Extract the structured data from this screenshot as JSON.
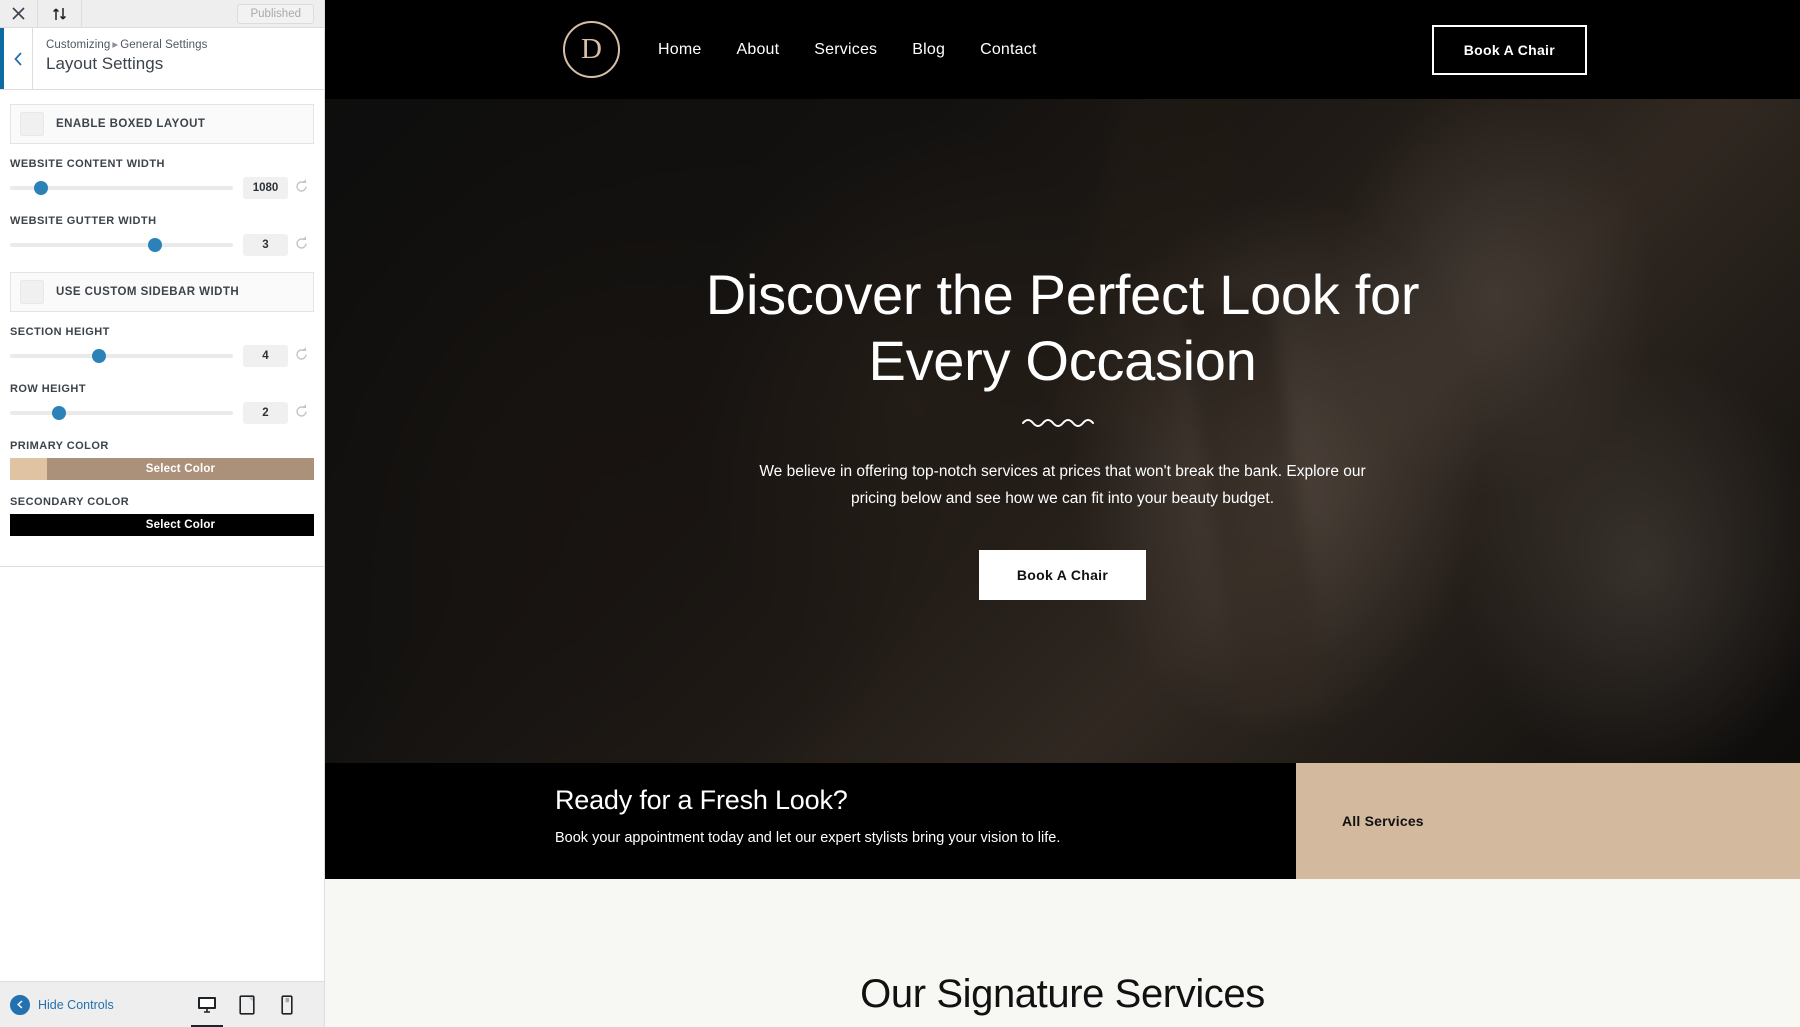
{
  "customizer": {
    "topbar": {
      "close_icon": "close-icon",
      "collapse_icon": "sort-arrows-icon",
      "published_label": "Published"
    },
    "header": {
      "back_icon": "chevron-left-icon",
      "breadcrumb_root": "Customizing",
      "breadcrumb_sep": "▸",
      "breadcrumb_section": "General Settings",
      "panel_title": "Layout Settings"
    },
    "controls": {
      "enable_boxed_layout": "ENABLE BOXED LAYOUT",
      "use_custom_sidebar_width": "USE CUSTOM SIDEBAR WIDTH",
      "sliders": [
        {
          "label": "WEBSITE CONTENT WIDTH",
          "value": "1080",
          "percent": 14,
          "reset_icon": "reset-icon"
        },
        {
          "label": "WEBSITE GUTTER WIDTH",
          "value": "3",
          "percent": 65,
          "reset_icon": "reset-icon"
        },
        {
          "label": "SECTION HEIGHT",
          "value": "4",
          "percent": 40,
          "reset_icon": "reset-icon"
        },
        {
          "label": "ROW HEIGHT",
          "value": "2",
          "percent": 22,
          "reset_icon": "reset-icon"
        }
      ],
      "primary_color": {
        "label": "PRIMARY COLOR",
        "button": "Select Color",
        "swatch_hex": "#e0c3a2",
        "bar_hex": "#ab9179"
      },
      "secondary_color": {
        "label": "SECONDARY COLOR",
        "button": "Select Color",
        "swatch_hex": "#000000",
        "bar_hex": "#000000"
      }
    },
    "footer": {
      "hide_controls": "Hide Controls",
      "hide_icon": "collapse-left-icon",
      "devices": [
        {
          "name": "desktop-icon",
          "active": true
        },
        {
          "name": "tablet-icon",
          "active": false
        },
        {
          "name": "mobile-icon",
          "active": false
        }
      ]
    }
  },
  "site": {
    "logo_letter": "D",
    "nav": [
      {
        "label": "Home"
      },
      {
        "label": "About"
      },
      {
        "label": "Services"
      },
      {
        "label": "Blog"
      },
      {
        "label": "Contact"
      }
    ],
    "header_cta": "Book A Chair",
    "hero": {
      "title_line1": "Discover the Perfect Look for",
      "title_line2": "Every Occasion",
      "divider_icon": "wave-divider-icon",
      "subtitle": "We believe in offering top-notch services at prices that won't break the bank. Explore our pricing below and see how we can fit into your beauty budget.",
      "cta": "Book A Chair"
    },
    "cta_band": {
      "heading": "Ready for a Fresh Look?",
      "text": "Book your appointment today and let our expert stylists bring your vision to life.",
      "link": "All Services",
      "accent_hex": "#d3b99d"
    },
    "services": {
      "title": "Our Signature Services"
    }
  }
}
